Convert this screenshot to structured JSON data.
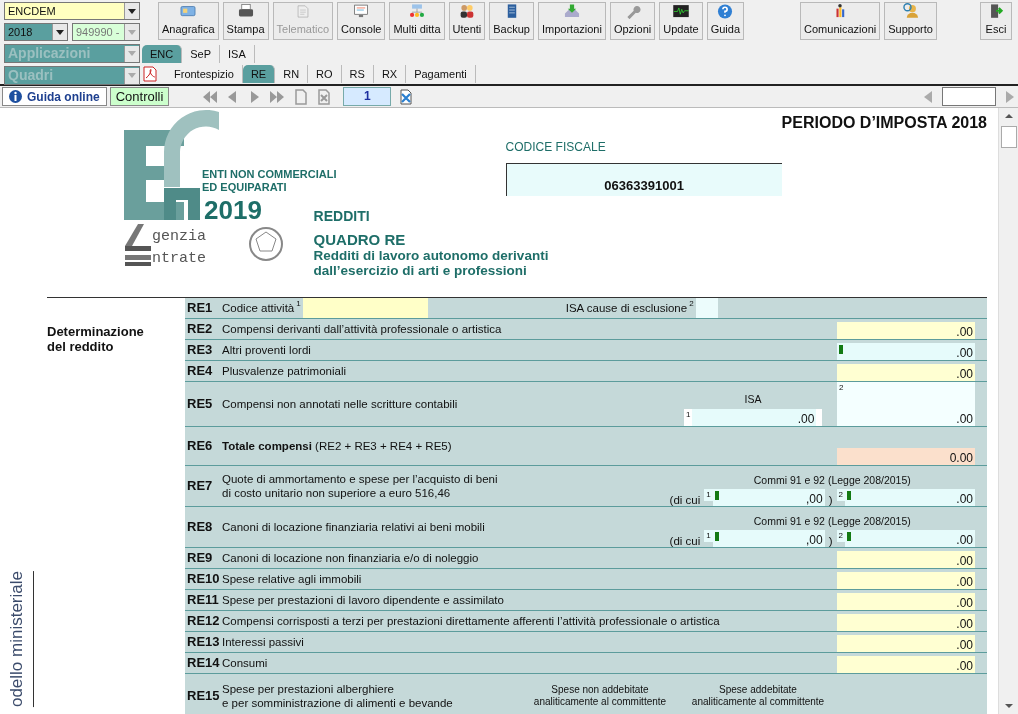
{
  "selectors": {
    "company_combo": {
      "value": "ENCDEM"
    },
    "year_combo": {
      "value": "2018"
    },
    "code_combo": {
      "value": "949990 -"
    },
    "applications_combo": {
      "value": "Applicazioni"
    },
    "sections_combo": {
      "value": "Quadri"
    }
  },
  "toolbar": [
    {
      "label": "Anagrafica",
      "disabled": false
    },
    {
      "label": "Stampa",
      "disabled": false
    },
    {
      "label": "Telematico",
      "disabled": true
    },
    {
      "label": "Console",
      "disabled": false
    },
    {
      "label": "Multi ditta",
      "disabled": false
    },
    {
      "label": "Utenti",
      "disabled": false
    },
    {
      "label": "Backup",
      "disabled": false
    },
    {
      "label": "Importazioni",
      "disabled": false
    },
    {
      "label": "Opzioni",
      "disabled": false
    },
    {
      "label": "Update",
      "disabled": false
    },
    {
      "label": "Guida",
      "disabled": false
    }
  ],
  "toolbar_right": [
    {
      "label": "Comunicazioni"
    },
    {
      "label": "Supporto"
    }
  ],
  "exit_button": {
    "label": "Esci"
  },
  "tabs": [
    {
      "label": "ENC",
      "selected": true
    },
    {
      "label": "SeP",
      "selected": false
    },
    {
      "label": "ISA",
      "selected": false
    }
  ],
  "subtabs": [
    {
      "label": "Frontespizio",
      "selected": false
    },
    {
      "label": "RE",
      "selected": true
    },
    {
      "label": "RN",
      "selected": false
    },
    {
      "label": "RO",
      "selected": false
    },
    {
      "label": "RS",
      "selected": false
    },
    {
      "label": "RX",
      "selected": false
    },
    {
      "label": "Pagamenti",
      "selected": false
    }
  ],
  "navbar": {
    "help_button": "Guida online",
    "checks_button": "Controlli",
    "page": "1"
  },
  "form": {
    "period": "PERIODO D’IMPOSTA 2018",
    "logo": {
      "line1": "ENTI NON COMMERCIALI",
      "line2": "ED EQUIPARATI",
      "year": "2019",
      "agency_top": "genzia",
      "agency_bottom": "ntrate"
    },
    "tax_code_label": "CODICE FISCALE",
    "tax_code": "06363391001",
    "section": "REDDITI",
    "title": "QUADRO RE",
    "subtitle": [
      "Redditi di lavoro autonomo derivanti",
      "dall’esercizio di arti e professioni"
    ],
    "group_label": "Determinazione del reddito",
    "side_label": "odello ministeriale",
    "rows": [
      {
        "kind": "code",
        "code": "RE1",
        "label": "Codice attività",
        "field_number": "1",
        "extra_label": "ISA cause di esclusione",
        "extra_number": "2"
      },
      {
        "kind": "amount",
        "code": "RE2",
        "label": "Compensi derivanti dall’attività professionale o artistica",
        "amount": {
          "value": ".00",
          "kind": "input",
          "marked": false
        }
      },
      {
        "kind": "amount",
        "code": "RE3",
        "label": "Altri proventi lordi",
        "amount": {
          "value": ".00",
          "kind": "calc",
          "marked": true
        }
      },
      {
        "kind": "amount",
        "code": "RE4",
        "label": "Plusvalenze patrimoniali",
        "amount": {
          "value": ".00",
          "kind": "input",
          "marked": false
        }
      },
      {
        "kind": "split",
        "code": "RE5",
        "label": "Compensi non annotati nelle scritture contabili",
        "heading": "ISA",
        "sub": {
          "number": "1",
          "value": ".00",
          "marked": false
        },
        "amount": {
          "number": "2",
          "value": ".00",
          "kind": "plain",
          "marked": false
        }
      },
      {
        "kind": "total",
        "code": "RE6",
        "label": "**Totale compensi** (RE2 + RE3 + RE4 + RE5)",
        "amount": {
          "value": "0.00",
          "kind": "total",
          "marked": false
        }
      },
      {
        "kind": "commi",
        "code": "RE7",
        "label": [
          "Quote di ammortamento e spese per l’acquisto di beni",
          "di costo unitario non superiore a euro 516,46"
        ],
        "heading": "Commi 91 e 92 (Legge 208/2015)",
        "prefix": "(di cui",
        "close": ")",
        "sub": {
          "number": "1",
          "value": ",00",
          "marked": true
        },
        "amount": {
          "number": "2",
          "value": ".00",
          "kind": "calc",
          "marked": true
        }
      },
      {
        "kind": "commi",
        "code": "RE8",
        "label": [
          "Canoni di locazione finanziaria relativi ai beni mobili"
        ],
        "heading": "Commi 91 e 92 (Legge 208/2015)",
        "prefix": "(di cui",
        "close": ")",
        "sub": {
          "number": "1",
          "value": ",00",
          "marked": true
        },
        "amount": {
          "number": "2",
          "value": ".00",
          "kind": "calc",
          "marked": true
        }
      },
      {
        "kind": "amount",
        "code": "RE9",
        "label": "Canoni di locazione non finanziaria e/o di noleggio",
        "amount": {
          "value": ".00",
          "kind": "input",
          "marked": false
        }
      },
      {
        "kind": "amount",
        "code": "RE10",
        "label": "Spese relative agli immobili",
        "amount": {
          "value": ".00",
          "kind": "input",
          "marked": false
        }
      },
      {
        "kind": "amount",
        "code": "RE11",
        "label": "Spese per prestazioni di lavoro dipendente e assimilato",
        "amount": {
          "value": ".00",
          "kind": "input",
          "marked": false
        }
      },
      {
        "kind": "amount",
        "code": "RE12",
        "label": "Compensi corrisposti a terzi per prestazioni direttamente afferenti l’attività professionale o artistica",
        "amount": {
          "value": ".00",
          "kind": "input",
          "marked": false
        }
      },
      {
        "kind": "amount",
        "code": "RE13",
        "label": "Interessi passivi",
        "amount": {
          "value": ".00",
          "kind": "input",
          "marked": false
        }
      },
      {
        "kind": "amount",
        "code": "RE14",
        "label": "Consumi",
        "amount": {
          "value": ".00",
          "kind": "input",
          "marked": false
        }
      },
      {
        "kind": "columns",
        "code": "RE15",
        "label": [
          "Spese per prestazioni alberghiere",
          "e per somministrazione di alimenti e bevande"
        ],
        "headings": [
          [
            "Spese non addebitate",
            "analiticamente al committente"
          ],
          [
            "Spese addebitate",
            "analiticamente al committente"
          ]
        ]
      }
    ]
  }
}
